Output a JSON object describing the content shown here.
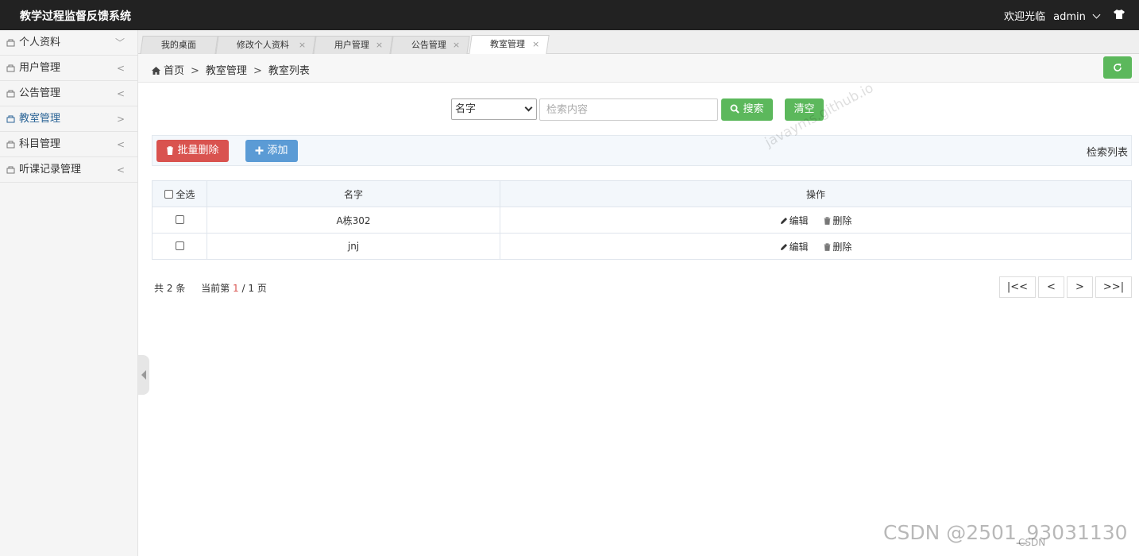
{
  "header": {
    "title": "教学过程监督反馈系统",
    "welcome": "欢迎光临",
    "user": "admin"
  },
  "sidebar": {
    "items": [
      {
        "label": "个人资料",
        "arrow": "﹀"
      },
      {
        "label": "用户管理",
        "arrow": "<"
      },
      {
        "label": "公告管理",
        "arrow": "<"
      },
      {
        "label": "教室管理",
        "arrow": ">"
      },
      {
        "label": "科目管理",
        "arrow": "<"
      },
      {
        "label": "听课记录管理",
        "arrow": "<"
      }
    ]
  },
  "tabs": [
    {
      "label": "我的桌面"
    },
    {
      "label": "修改个人资料",
      "close": "×"
    },
    {
      "label": "用户管理",
      "close": "×"
    },
    {
      "label": "公告管理",
      "close": "×"
    },
    {
      "label": "教室管理",
      "close": "×"
    }
  ],
  "breadcrumb": {
    "home": "首页",
    "sep": ">",
    "section": "教室管理",
    "page": "教室列表"
  },
  "search": {
    "field": "名字",
    "placeholder": "检索内容",
    "search_label": "搜索",
    "clear_label": "清空"
  },
  "toolbar": {
    "batch_delete": "批量删除",
    "add": "添加",
    "list_title": "检索列表"
  },
  "table": {
    "headers": {
      "select_all": "全选",
      "name": "名字",
      "actions": "操作"
    },
    "edit_label": "编辑",
    "delete_label": "删除",
    "rows": [
      {
        "name": "A栋302"
      },
      {
        "name": "jnj"
      }
    ]
  },
  "pager": {
    "total_prefix": "共",
    "total": "2",
    "total_suffix": "条",
    "current_prefix": "当前第",
    "current": "1",
    "sep": "/",
    "pages": "1",
    "pages_suffix": "页",
    "first": "|<<",
    "prev": "<",
    "next": ">",
    "last": ">>|"
  },
  "watermarks": {
    "diagonal": "javayms.github.io",
    "csdn": "CSDN @2501_93031130",
    "csdn_small": "CSDN"
  },
  "colors": {
    "topbar": "#222222",
    "success": "#5cb85c",
    "danger": "#d9534f",
    "primary": "#5b9bd5",
    "active_link": "#2a6496"
  }
}
